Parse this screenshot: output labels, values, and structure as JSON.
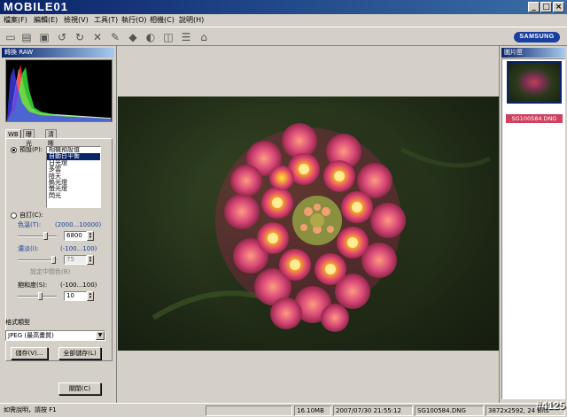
{
  "title_bar": {
    "logo": "MOBILE01",
    "min_label": "_",
    "max_label": "□",
    "close_label": "×"
  },
  "menu": [
    "檔案(F)",
    "編輯(E)",
    "檢視(V)",
    "工具(T)",
    "執行(O)",
    "相機(C)",
    "說明(H)"
  ],
  "toolbar": {
    "brand": "SAMSUNG"
  },
  "left_panel": {
    "header": "轉換 RAW",
    "tabs": [
      "WB",
      "曝光",
      "清晰度"
    ],
    "preset_label": "預設(P):",
    "wb_presets": [
      "相機預設值",
      "自動白平衡",
      "日光燈",
      "多雲",
      "陰天",
      "鎢光燈",
      "螢光燈",
      "閃光"
    ],
    "wb_selected_index": 1,
    "custom_label": "自訂(C):",
    "temp_label": "色溫(T):",
    "temp_range": "(2000...10000)",
    "temp_value": "6800",
    "tint_label": "濃淡(I):",
    "tint_range": "(-100...100)",
    "tint_value": "75",
    "middle_gray_label": "設定中間色(B)",
    "saturation_label": "飽和度(S):",
    "saturation_range": "(-100...100)",
    "saturation_value": "10",
    "format_label": "格式類型",
    "format_value": "JPEG (最高畫質)",
    "save_button": "儲存(V)...",
    "save_all_button": "全部儲存(L)",
    "close_button": "關閉(C)"
  },
  "right_panel": {
    "header": "圖片匣",
    "thumb_name": "SG100584.DNG"
  },
  "status_bar": {
    "help": "如需說明，請按 F1",
    "size": "16.10MB",
    "date": "2007/07/30 21:55:12",
    "filename": "SG100584.DNG",
    "resolution": "3872x2592, 24 Bits"
  },
  "watermark": "#4125",
  "colors": {
    "accent": "#0a246a",
    "face": "#d4d0c8",
    "thumb_label_bg": "#d04060"
  }
}
